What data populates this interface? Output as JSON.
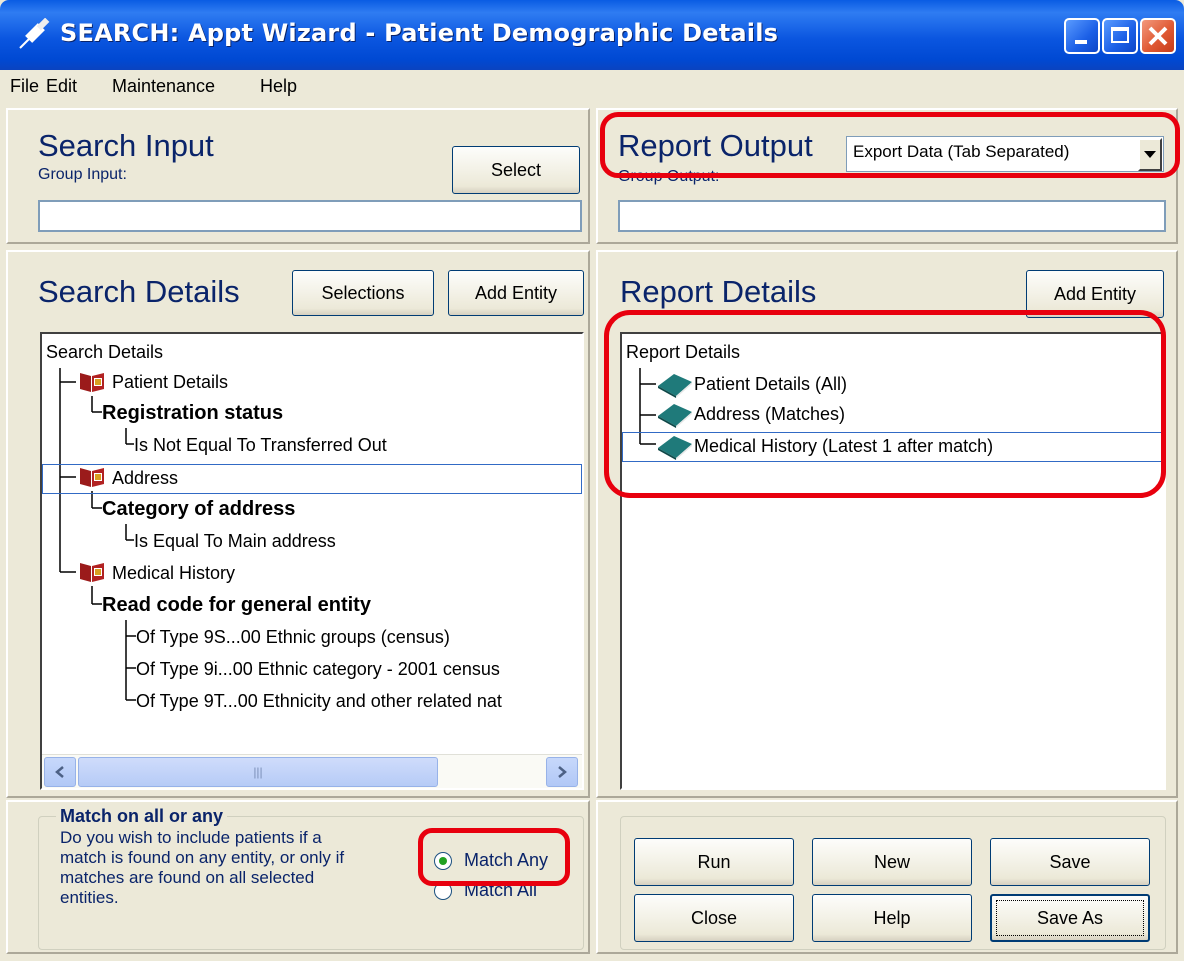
{
  "window": {
    "title": "SEARCH: Appt Wizard - Patient Demographic Details"
  },
  "menu": [
    "File",
    "Edit",
    "Maintenance",
    "Help"
  ],
  "search_input": {
    "heading": "Search Input",
    "group_label": "Group Input:",
    "group_value": "",
    "select_button": "Select"
  },
  "report_output": {
    "heading": "Report Output",
    "format": "Export Data (Tab Separated)",
    "group_label": "Group Output:",
    "group_value": ""
  },
  "search_details": {
    "heading": "Search Details",
    "selections_button": "Selections",
    "add_entity_button": "Add Entity",
    "tree": {
      "root": "Search Details",
      "patient_details": "Patient Details",
      "registration_status": "Registration status",
      "transferred_out": "Is Not Equal To Transferred Out",
      "address": "Address",
      "category_of_address": "Category of address",
      "main_address": "Is Equal To Main address",
      "medical_history": "Medical History",
      "read_code": "Read code for general entity",
      "type_1": "Of Type 9S...00 Ethnic groups (census)",
      "type_2": "Of Type 9i...00 Ethnic category - 2001 census",
      "type_3": "Of Type 9T...00 Ethnicity and other related nat"
    }
  },
  "match": {
    "title": "Match on all or any",
    "desc_1": "Do you wish to include patients if a",
    "desc_2": "match is found on any entity, or only if",
    "desc_3": "matches are found on all selected",
    "desc_4": "entities.",
    "match_any": "Match Any",
    "match_all": "Match All",
    "selected": "Match Any"
  },
  "report_details": {
    "heading": "Report Details",
    "add_entity_button": "Add Entity",
    "tree": {
      "root": "Report Details",
      "item_1": "Patient Details (All)",
      "item_2": "Address (Matches)",
      "item_3": "Medical History (Latest 1 after match)"
    }
  },
  "actions": {
    "run": "Run",
    "new": "New",
    "save": "Save",
    "close": "Close",
    "help": "Help",
    "save_as": "Save As"
  },
  "colors": {
    "title_bar": "#0a5ce3",
    "heading_text": "#0a246a",
    "annotation": "#e8000e",
    "face": "#ece9d8"
  }
}
